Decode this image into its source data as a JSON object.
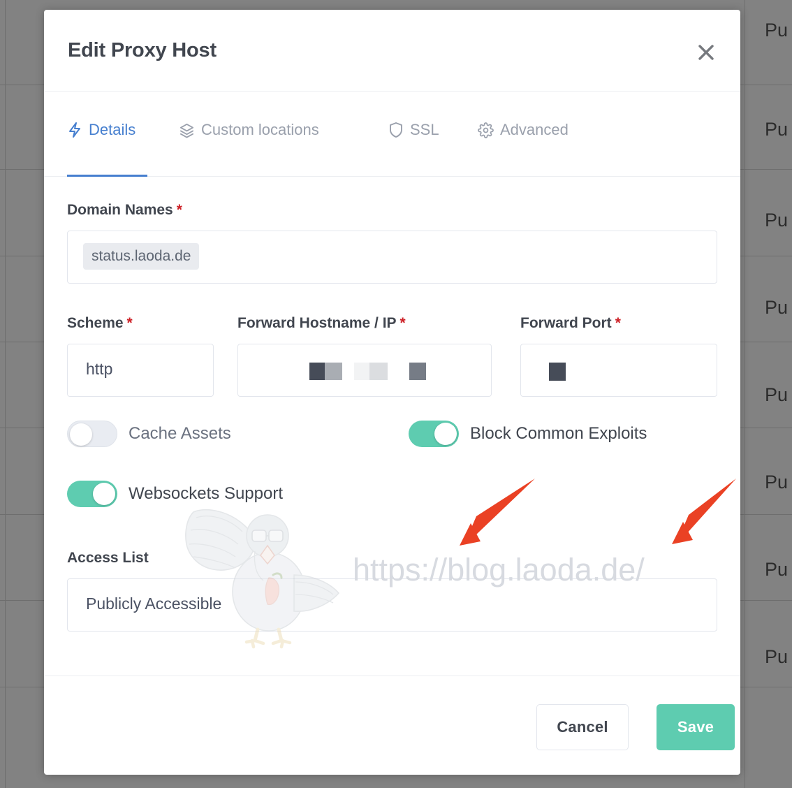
{
  "background": {
    "row_label": "Pu",
    "row_count": 8,
    "overlay_color": "#828282"
  },
  "modal": {
    "title": "Edit Proxy Host",
    "close_icon": "close-icon"
  },
  "tabs": [
    {
      "label": "Details",
      "icon": "lightning-bolt-icon",
      "active": true
    },
    {
      "label": "Custom locations",
      "icon": "layers-icon",
      "active": false
    },
    {
      "label": "SSL",
      "icon": "shield-icon",
      "active": false
    },
    {
      "label": "Advanced",
      "icon": "gear-icon",
      "active": false
    }
  ],
  "form": {
    "domain_names": {
      "label": "Domain Names",
      "required_marker": "*",
      "tags": [
        "status.laoda.de"
      ]
    },
    "scheme": {
      "label": "Scheme",
      "required_marker": "*",
      "value": "http"
    },
    "forward_hostname": {
      "label": "Forward Hostname / IP",
      "required_marker": "*",
      "value": "",
      "redacted": true
    },
    "forward_port": {
      "label": "Forward Port",
      "required_marker": "*",
      "value": "",
      "redacted": true
    },
    "access_list": {
      "label": "Access List",
      "value": "Publicly Accessible"
    }
  },
  "toggles": [
    {
      "label": "Cache Assets",
      "state": "off"
    },
    {
      "label": "Block Common Exploits",
      "state": "on"
    },
    {
      "label": "Websockets Support",
      "state": "on"
    }
  ],
  "footer": {
    "cancel_label": "Cancel",
    "save_label": "Save"
  },
  "watermark": {
    "url_text": "https://blog.laoda.de/",
    "illustration": "pigeon-illustration"
  },
  "annotations": {
    "arrow_color": "#ea4124",
    "arrows": [
      {
        "name": "arrow-forward-hostname"
      },
      {
        "name": "arrow-forward-port"
      }
    ]
  },
  "colors": {
    "accent_blue": "#467fcf",
    "accent_teal": "#5eccb0",
    "required_red": "#cd2026",
    "text_dark": "#41464f",
    "muted": "#9aa0ac"
  }
}
